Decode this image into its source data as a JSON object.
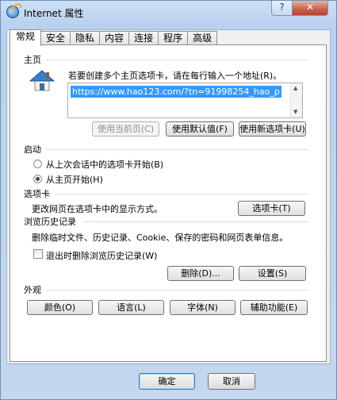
{
  "window": {
    "title": "Internet 属性",
    "help_label": "?",
    "close_label": "✕"
  },
  "tabs": [
    "常规",
    "安全",
    "隐私",
    "内容",
    "连接",
    "程序",
    "高级"
  ],
  "home": {
    "section_label": "主页",
    "instruction": "若要创建多个主页选项卡，请在每行输入一个地址(R)。",
    "url": "https://www.hao123.com/?tn=91998254_hao_p",
    "use_current": "使用当前页(C)",
    "use_default": "使用默认值(F)",
    "use_new_tab": "使用新选项卡(U)"
  },
  "startup": {
    "section_label": "启动",
    "option_last_session": "从上次会话中的选项卡开始(B)",
    "option_home": "从主页开始(H)",
    "selected": "option_home"
  },
  "tabs_section": {
    "section_label": "选项卡",
    "description": "更改网页在选项卡中的显示方式。",
    "button": "选项卡(T)"
  },
  "history": {
    "section_label": "浏览历史记录",
    "description": "删除临时文件、历史记录、Cookie、保存的密码和网页表单信息。",
    "delete_on_exit": "退出时删除浏览历史记录(W)",
    "delete_on_exit_checked": false,
    "delete_button": "删除(D)...",
    "settings_button": "设置(S)"
  },
  "appearance": {
    "section_label": "外观",
    "colors": "颜色(O)",
    "languages": "语言(L)",
    "fonts": "字体(N)",
    "accessibility": "辅助功能(E)"
  },
  "footer": {
    "ok": "确定",
    "cancel": "取消"
  }
}
